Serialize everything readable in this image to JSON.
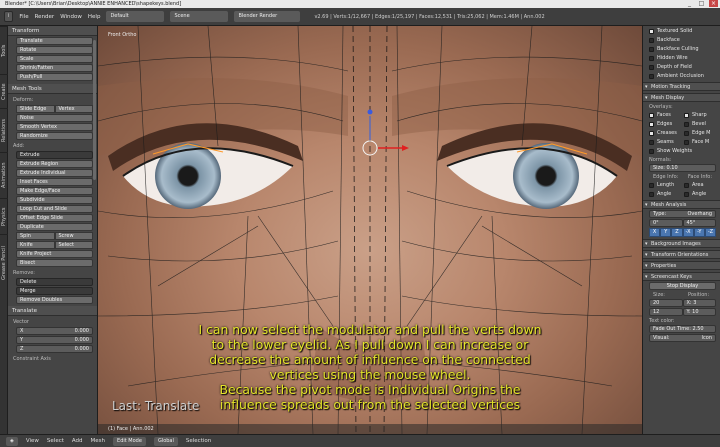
{
  "window": {
    "title": "Blender* [C:\\Users\\Brian\\Desktop\\ANNIE ENHANCED\\shapekeys.blend]",
    "min": "_",
    "max": "□",
    "close": "×"
  },
  "header": {
    "menus": [
      "File",
      "Render",
      "Window",
      "Help"
    ],
    "screen": "Default",
    "scene": "Scene",
    "engine": "Blender Render",
    "stats": "v2.69 | Verts:1/12,667 | Edges:1/25,197 | Faces:12,531 | Tris:25,062 | Mem:1.46M | Ann.002"
  },
  "left_tabs": [
    "Tools",
    "Create",
    "Relations",
    "Animation",
    "Physics",
    "Grease Pencil"
  ],
  "toolshelf": {
    "transform_title": "Transform",
    "transform_buttons": [
      "Translate",
      "Rotate",
      "Scale",
      "Shrink/Fatten",
      "Push/Pull"
    ],
    "mesh_tools_title": "Mesh Tools",
    "deform_label": "Deform:",
    "deform_buttons": [
      "Slide Edge",
      "Vertex",
      "Noise",
      "Smooth Vertex",
      "Randomize"
    ],
    "add_label": "Add:",
    "add_dropdown": "Extrude",
    "add_buttons": [
      "Extrude Region",
      "Extrude Individual",
      "Inset Faces",
      "Make Edge/Face",
      "Subdivide",
      "Loop Cut and Slide",
      "Offset Edge Slide",
      "Duplicate"
    ],
    "split_row": [
      "Spin",
      "Screw"
    ],
    "knife_row": [
      "Knife",
      "Select"
    ],
    "knife_project": "Knife Project",
    "bisect": "Bisect",
    "remove_label": "Remove:",
    "remove_dropdowns": [
      "Delete",
      "Merge"
    ],
    "remove_doubles": "Remove Doubles",
    "translate_title": "Translate",
    "vector_label": "Vector",
    "vector": [
      {
        "axis": "X",
        "value": "0.000"
      },
      {
        "axis": "Y",
        "value": "0.000"
      },
      {
        "axis": "Z",
        "value": "0.000"
      }
    ],
    "constraint_label": "Constraint Axis"
  },
  "viewport": {
    "view_label": "Front Ortho",
    "caption_lines": [
      "I can now select the modulator and pull the verts down",
      "to the lower eyelid. As I pull down I can increase or",
      "decrease the amount of influence on the connected",
      "vertices using the mouse wheel.",
      "Because the pivot mode is Individual Origins the",
      "influence spreads out from the selected vertices"
    ],
    "last_operator": "Last: Translate",
    "footer": "(1) Face | Ann.002"
  },
  "props": {
    "top_checks": [
      {
        "label": "Textured Solid",
        "on": true
      },
      {
        "label": "Backface",
        "on": false
      },
      {
        "label": "Backface Culling",
        "on": false
      },
      {
        "label": "Hidden Wire",
        "on": false
      },
      {
        "label": "Depth of Field",
        "on": false
      },
      {
        "label": "Ambient Occlusion",
        "on": false
      }
    ],
    "motion_tracking": "Motion Tracking",
    "mesh_display": "Mesh Display",
    "overlays_label": "Overlays:",
    "overlay_checks": [
      {
        "label": "Faces",
        "on": true
      },
      {
        "label": "Sharp",
        "on": true
      },
      {
        "label": "Edges",
        "on": true
      },
      {
        "label": "Bevel",
        "on": false
      },
      {
        "label": "Creases",
        "on": true
      },
      {
        "label": "Edge M",
        "on": false
      },
      {
        "label": "Seams",
        "on": false
      },
      {
        "label": "Face M",
        "on": false
      }
    ],
    "show_weights": "Show Weights",
    "normals_label": "Normals:",
    "normals_size": "Size: 0.10",
    "edge_info_label": "Edge Info:",
    "face_info_label": "Face Info:",
    "info_checks": [
      {
        "label": "Length",
        "on": false
      },
      {
        "label": "Area",
        "on": false
      },
      {
        "label": "Angle",
        "on": false
      },
      {
        "label": "Angle",
        "on": false
      }
    ],
    "mesh_analysis": "Mesh Analysis",
    "analysis_type_label": "Type:",
    "analysis_type": "Overhang",
    "analysis_range": [
      "0°",
      "45°"
    ],
    "axis_buttons": [
      "X",
      "Y",
      "Z",
      "-X",
      "-Y",
      "-Z"
    ],
    "background_images": "Background Images",
    "transform_orientations": "Transform Orientations",
    "properties_label": "Properties",
    "screencast_keys": "Screencast Keys",
    "stop_display": "Stop Display",
    "size_label": "Size:",
    "position_label": "Position:",
    "size_value": "20",
    "position_value": "X: 3",
    "size_value2": "12",
    "position_value2": "Y: 10",
    "text_color_label": "Text color:",
    "fade_out_time": "Fade Out Time: 2.50",
    "visual_label": "Visual:",
    "visual_value": "Icon"
  },
  "bottombar": {
    "view_menus": [
      "View",
      "Select",
      "Add",
      "Mesh"
    ],
    "mode": "Edit Mode",
    "pivot": "Global",
    "extra": "Selection"
  }
}
